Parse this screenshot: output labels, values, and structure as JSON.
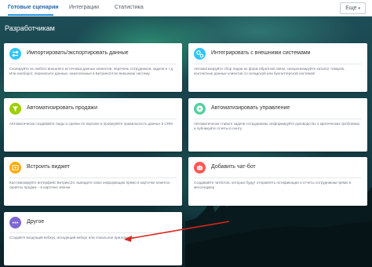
{
  "tabs": [
    {
      "label": "Готовые сценарии",
      "active": true
    },
    {
      "label": "Интеграции",
      "active": false
    },
    {
      "label": "Статистика",
      "active": false
    }
  ],
  "more_button": "Еще",
  "page_title": "Разработчикам",
  "cards": [
    {
      "id": "import-export",
      "icon": "swap-arrows-icon",
      "color": "#2fc6f6",
      "title": "Импортировать/экспортировать данные",
      "desc": "Скопируйте из любого внешнего источника данных клиентов, перечень сотрудников, задачи и т.д. Или наоборот, перенесите данные, накопленные в Битрикс24 во внешнюю систему"
    },
    {
      "id": "integrate",
      "icon": "gears-icon",
      "color": "#2fc6f6",
      "title": "Интегрировать с внешними системами",
      "desc": "Автоматизируйте сбор лидов из форм обратной связи, синхронизируйте каталог товаров, контактные данные клиентов со складской или бухгалтерской системой"
    },
    {
      "id": "automate-sales",
      "icon": "funnel-icon",
      "color": "#9dcf00",
      "title": "Автоматизировать продажи",
      "desc": "Автоматически создавайте лиды и сделки по воронке и проверяйте правильность данных в CRM"
    },
    {
      "id": "automate-management",
      "icon": "play-icon",
      "color": "#55d0a0",
      "title": "Автоматизировать управление",
      "desc": "Автоматически ставьте задачи сотрудникам, информируйте руководство о критических проблемах и публикуйте отчеты в ленту"
    },
    {
      "id": "widget",
      "icon": "widget-icon",
      "color": "#ffa900",
      "title": "Встроить виджет",
      "desc": "Кастомизируйте интерфейс Битрикс24: выводите свою информацию прямо в карточке клиента, скрипты продаж – в карточке звонка"
    },
    {
      "id": "chatbot",
      "icon": "bot-icon",
      "color": "#ff5752",
      "title": "Добавить чат-бот",
      "desc": "Создавайте чатботов, которые будут отправлять нотификации и отчеты сотрудникам прямо в мессенджер"
    },
    {
      "id": "other",
      "icon": "dots-icon",
      "color": "#7f68d4",
      "title": "Другое",
      "desc": "Создайте входящий вебхук, исходящий вебхук или локальное приложение"
    }
  ]
}
